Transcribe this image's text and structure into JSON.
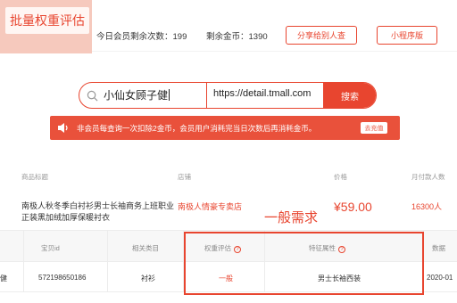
{
  "header": {
    "title_button": "批量权重评估",
    "members_remaining": "今日会员剩余次数：199",
    "coins_remaining": "剩余金币：1390",
    "share_button": "分享给别人查",
    "mini_program_button": "小程序版"
  },
  "search": {
    "keyword": "小仙女顾子健",
    "url": "https://detail.tmall.com",
    "button": "搜索"
  },
  "notice": {
    "text": "非会员每查询一次扣除2金币，会员用户消耗完当日次数后再消耗金币。",
    "button": "去充值"
  },
  "product_header": {
    "title": "商品标题",
    "shop": "店铺",
    "price": "价格",
    "monthly_buyers": "月付款人数"
  },
  "product": {
    "title": "南极人秋冬季白衬衫男士长袖商务上班职业正装黑加绒加厚保暖衬衣",
    "shop": "南极人情豪专卖店",
    "price": "¥59.00",
    "buyers": "16300人"
  },
  "annotation": "一般需求",
  "table": {
    "headers": [
      "宝贝id",
      "相关类目",
      "权重评估",
      "特征属性",
      "数据"
    ],
    "row": {
      "first_cell": "健",
      "item_id": "572198650186",
      "category": "衬衫",
      "weight": "一般",
      "feature": "男士长袖西装",
      "date": "2020-01"
    }
  },
  "colors": {
    "accent": "#e8452f",
    "notice_bg": "#e9513b"
  }
}
